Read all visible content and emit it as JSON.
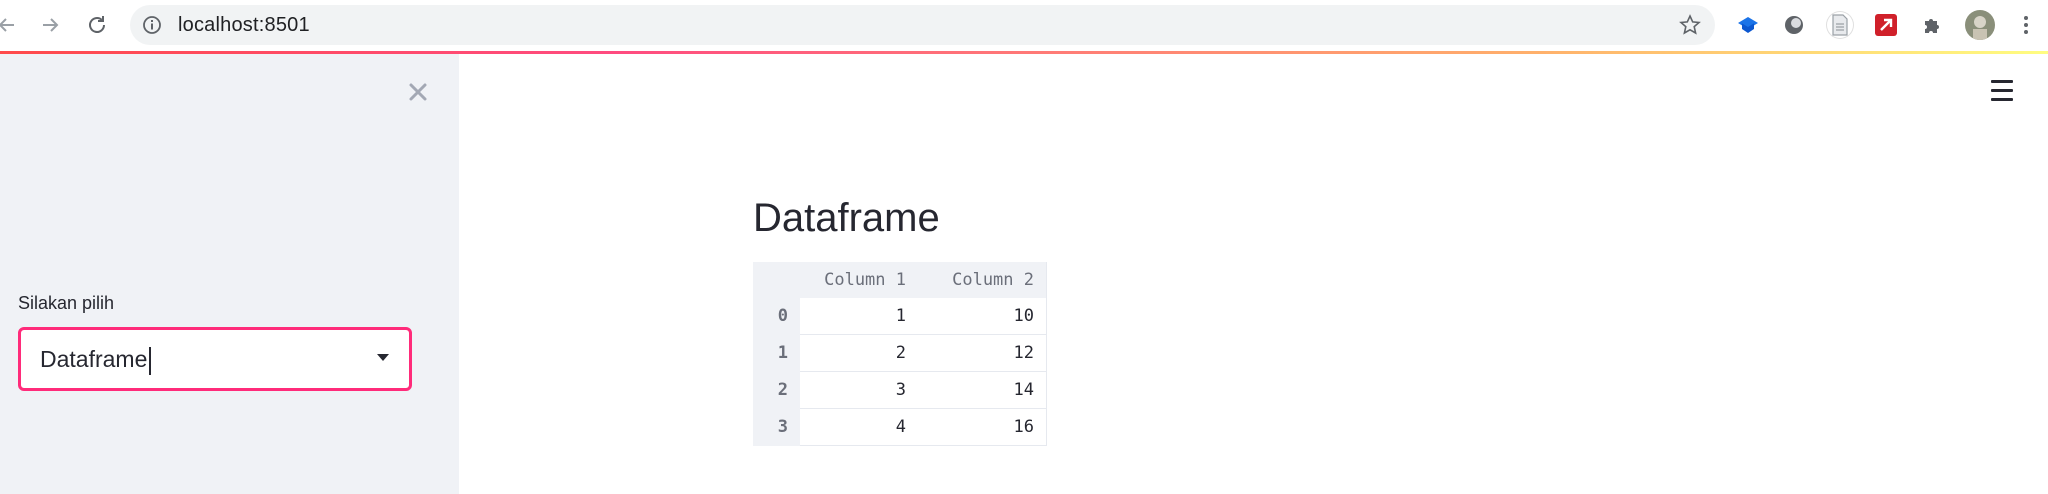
{
  "browser": {
    "url": "localhost:8501"
  },
  "sidebar": {
    "select_label": "Silakan pilih",
    "select_value": "Dataframe"
  },
  "main": {
    "title": "Dataframe",
    "table": {
      "columns": [
        "Column 1",
        "Column 2"
      ],
      "rows": [
        {
          "index": "0",
          "c1": "1",
          "c2": "10"
        },
        {
          "index": "1",
          "c1": "2",
          "c2": "12"
        },
        {
          "index": "2",
          "c1": "3",
          "c2": "14"
        },
        {
          "index": "3",
          "c1": "4",
          "c2": "16"
        }
      ]
    }
  },
  "colors": {
    "accent": "#ff2b7a",
    "sidebar_bg": "#f0f2f6",
    "text": "#262730"
  },
  "icons": [
    "back-icon",
    "forward-icon",
    "reload-icon",
    "info-icon",
    "star-icon",
    "puzzle-icon",
    "more-icon",
    "close-icon",
    "hamburger-icon",
    "chevron-down-icon"
  ]
}
